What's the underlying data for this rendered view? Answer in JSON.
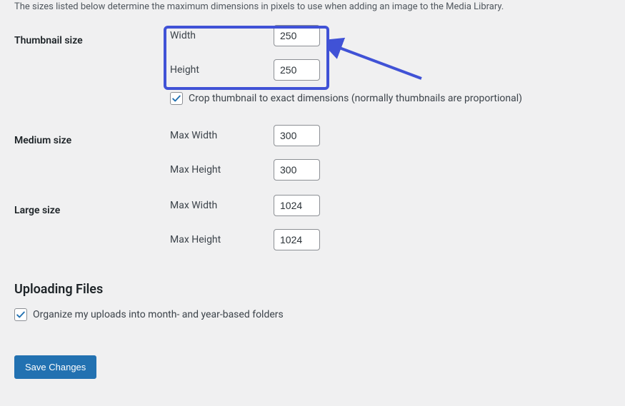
{
  "intro": "The sizes listed below determine the maximum dimensions in pixels to use when adding an image to the Media Library.",
  "thumbnail": {
    "title": "Thumbnail size",
    "width_label": "Width",
    "width_value": "250",
    "height_label": "Height",
    "height_value": "250",
    "crop_label": "Crop thumbnail to exact dimensions (normally thumbnails are proportional)",
    "crop_checked": true
  },
  "medium": {
    "title": "Medium size",
    "max_width_label": "Max Width",
    "max_width_value": "300",
    "max_height_label": "Max Height",
    "max_height_value": "300"
  },
  "large": {
    "title": "Large size",
    "max_width_label": "Max Width",
    "max_width_value": "1024",
    "max_height_label": "Max Height",
    "max_height_value": "1024"
  },
  "uploading": {
    "heading": "Uploading Files",
    "organize_label": "Organize my uploads into month- and year-based folders",
    "organize_checked": true
  },
  "save_button": "Save Changes",
  "annotation": {
    "highlight_color": "#4052d6"
  }
}
